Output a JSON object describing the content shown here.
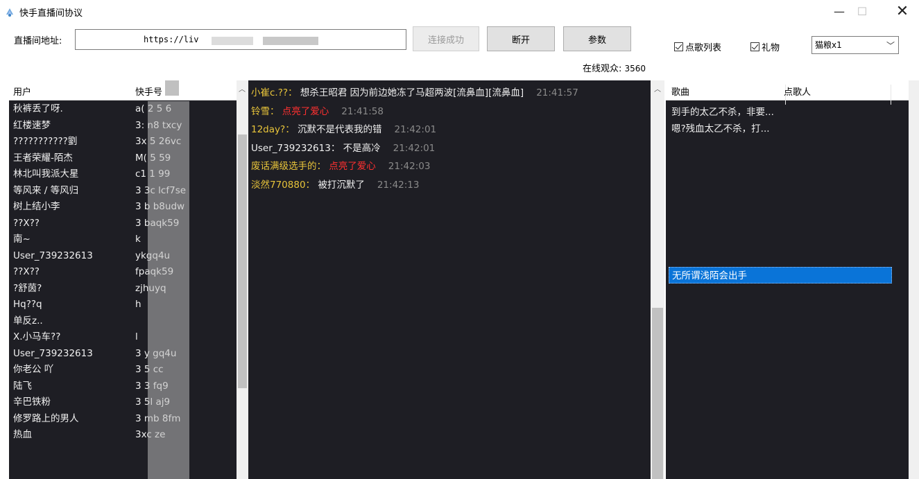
{
  "window": {
    "title": "快手直播间协议",
    "minimize": "—",
    "maximize": "☐",
    "close": "✕"
  },
  "toolbar": {
    "address_label": "直播间地址:",
    "address_value": "https://liv",
    "connect_label": "连接成功",
    "disconnect_label": "断开",
    "params_label": "参数",
    "viewers_label": "在线观众:",
    "viewers_count": "3560",
    "song_list_label": "点歌列表",
    "gift_label": "礼物",
    "gift_select_value": "猫粮x1",
    "song_list_checked": true,
    "gift_checked": true
  },
  "users": {
    "columns": [
      "用户",
      "快手号"
    ],
    "rows": [
      {
        "name": "秋裤丢了呀.",
        "id": "a(   2   5  6"
      },
      {
        "name": "红楼速梦",
        "id": "3:          n8   txcy"
      },
      {
        "name": "???????????劉",
        "id": "3x          5    26vc"
      },
      {
        "name": "王者荣耀-陌杰",
        "id": "M(         5     59"
      },
      {
        "name": "林北叫我派大星",
        "id": "c1          1    99"
      },
      {
        "name": "等风来 / 等风归",
        "id": "3          3c   lcf7se"
      },
      {
        "name": "树上结小李",
        "id": "3           b    b8udw"
      },
      {
        "name": "??X??",
        "id": "3            baqk59"
      },
      {
        "name": "南~",
        "id": "k"
      },
      {
        "name": "User_739232613",
        "id": "            ykgq4u"
      },
      {
        "name": "??X??",
        "id": "            fpaqk59"
      },
      {
        "name": "?舒茵?",
        "id": "            zjhuyq"
      },
      {
        "name": "Hq??q",
        "id": "            h"
      },
      {
        "name": "单反z..",
        "id": ""
      },
      {
        "name": "X.小马车??",
        "id": "l"
      },
      {
        "name": "User_739232613",
        "id": "3           y  gq4u"
      },
      {
        "name": "你老公  吖",
        "id": "3            5    cc"
      },
      {
        "name": "陆飞",
        "id": "3            3    fq9"
      },
      {
        "name": "辛巴铁粉",
        "id": "3            5l   aj9"
      },
      {
        "name": "修罗路上的男人",
        "id": "3            mb   8fm"
      },
      {
        "name": "热血",
        "id": "3xc               ze"
      }
    ]
  },
  "chat": [
    {
      "user": "小崔c.??",
      "user_color": "yellow",
      "text": "想杀王昭君 因为前边她冻了马超两波[流鼻血][流鼻血]",
      "gift": false,
      "time": "21:41:57"
    },
    {
      "user": "铃雪",
      "user_color": "yellow",
      "text": "点亮了爱心",
      "gift": true,
      "time": "21:41:58"
    },
    {
      "user": "12day?",
      "user_color": "yellow",
      "text": "沉默不是代表我的错",
      "gift": false,
      "time": "21:42:01"
    },
    {
      "user": "User_739232613",
      "user_color": "white",
      "text": "不是高冷",
      "gift": false,
      "time": "21:42:01"
    },
    {
      "user": "废话满级选手的",
      "user_color": "yellow",
      "text": "点亮了爱心",
      "gift": true,
      "time": "21:42:03"
    },
    {
      "user": "淡然770880",
      "user_color": "yellow",
      "text": "被打沉默了",
      "gift": false,
      "time": "21:42:13"
    }
  ],
  "songs": {
    "columns": [
      "歌曲",
      "点歌人"
    ],
    "rows": [
      {
        "song": "到手的太乙不杀，非要...",
        "requester": ""
      },
      {
        "song": "嗯?残血太乙不杀，打...",
        "requester": ""
      }
    ],
    "selected": "无所谓浅陌会出手"
  },
  "colors": {
    "panel_bg": "#1e1e24",
    "user_yellow": "#e8c43a",
    "gift_red": "#ff3030",
    "time_gray": "#8a8a8a",
    "selection_blue": "#0a74d8"
  }
}
